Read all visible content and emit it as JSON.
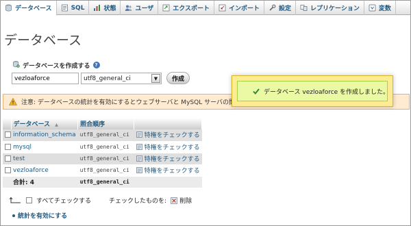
{
  "tabs": [
    {
      "label": "データベース",
      "icon": "database-icon",
      "active": true
    },
    {
      "label": "SQL",
      "icon": "sql-icon"
    },
    {
      "label": "状態",
      "icon": "status-icon"
    },
    {
      "label": "ユーザ",
      "icon": "users-icon"
    },
    {
      "label": "エクスポート",
      "icon": "export-icon"
    },
    {
      "label": "インポート",
      "icon": "import-icon"
    },
    {
      "label": "設定",
      "icon": "wrench-icon"
    },
    {
      "label": "レプリケーション",
      "icon": "replication-icon"
    },
    {
      "label": "変数",
      "icon": "variables-icon"
    }
  ],
  "page_title": "データベース",
  "create": {
    "label": "データベースを作成する",
    "db_name_value": "vezloaforce",
    "collation_value": "utf8_general_ci",
    "button_label": "作成"
  },
  "notice": {
    "text": "注意: データベースの統計を有効にするとウェブサーバと MySQL サーバの間の通信"
  },
  "table": {
    "headers": {
      "database": "データベース",
      "sort_indicator": "▲",
      "collation": "照合順序"
    },
    "rows": [
      {
        "name": "information_schema",
        "collation": "utf8_general_ci",
        "action": "特権をチェックする"
      },
      {
        "name": "mysql",
        "collation": "utf8_general_ci",
        "action": "特権をチェックする"
      },
      {
        "name": "test",
        "collation": "utf8_general_ci",
        "action": "特権をチェックする"
      },
      {
        "name": "vezloaforce",
        "collation": "utf8_general_ci",
        "action": "特権をチェックする"
      }
    ],
    "footer": {
      "total_label": "合計: 4",
      "collation": "utf8_general_ci"
    }
  },
  "bulk": {
    "check_all_label": "すべてチェックする",
    "with_selected_label": "チェックしたものを:",
    "delete_label": "削除"
  },
  "enable_stats_label": "統計を有効にする",
  "popup": {
    "message": "データベース vezloaforce を作成しました。"
  },
  "colors": {
    "link": "#235a81",
    "popup_outer": "#ffeb91",
    "popup_inner": "#ebf8a4",
    "notice_bg": "#ffebd2"
  }
}
